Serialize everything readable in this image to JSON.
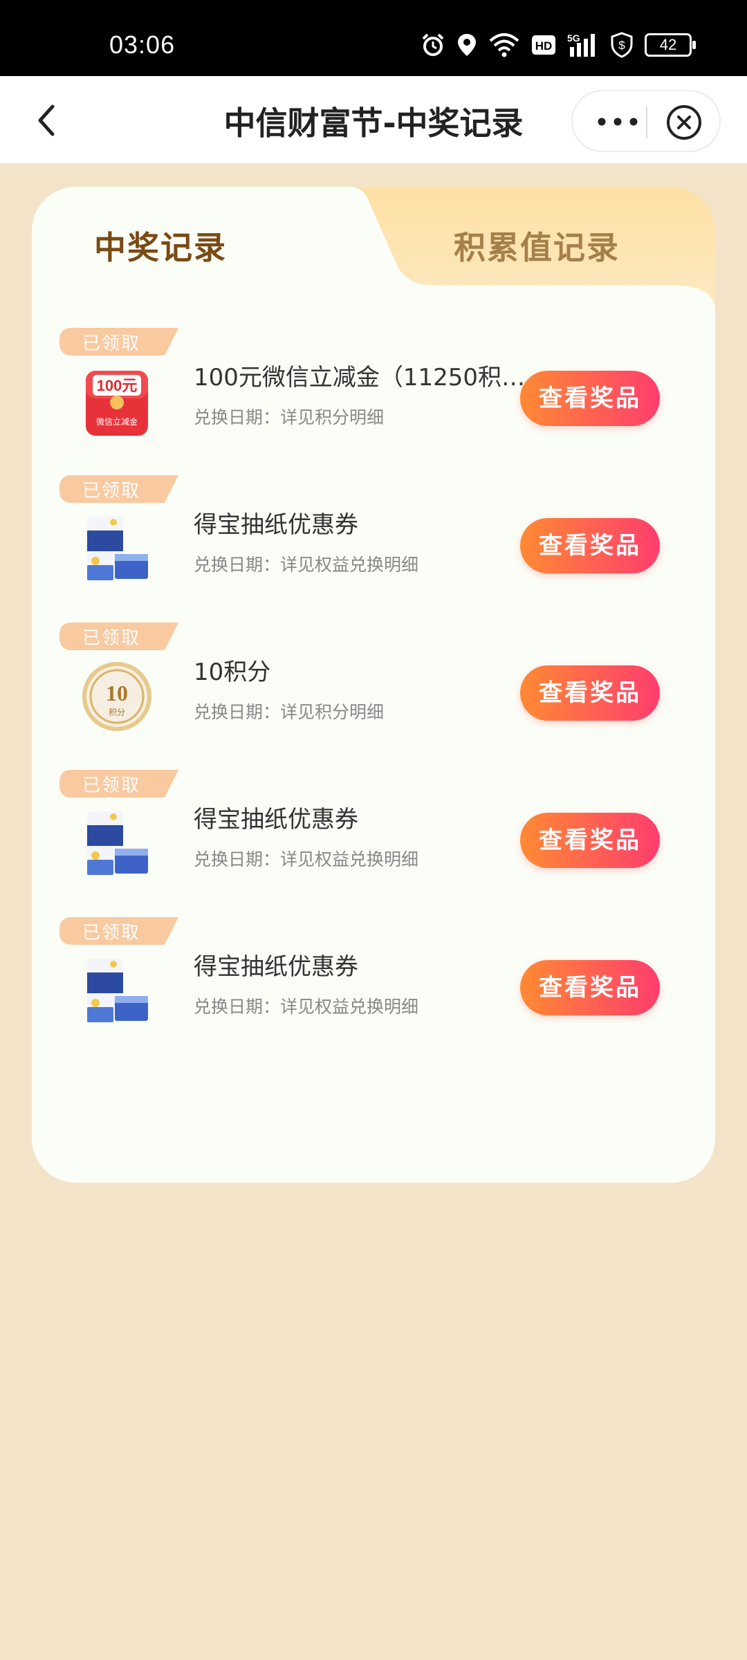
{
  "status_bar": {
    "time": "03:06",
    "network": "5G",
    "hd": "HD",
    "battery": "42",
    "icons": [
      "alarm-icon",
      "location-icon",
      "wifi-icon",
      "hd-icon",
      "signal-5g-icon",
      "shield-dollar-icon",
      "battery-icon"
    ]
  },
  "nav": {
    "title": "中信财富节-中奖记录",
    "back_icon": "chevron-left-icon",
    "more_icon": "more-dots-icon",
    "close_icon": "close-circle-icon"
  },
  "tabs": [
    {
      "label": "中奖记录",
      "active": true
    },
    {
      "label": "积累值记录",
      "active": false
    }
  ],
  "colors": {
    "background": "#f3e4c9",
    "tab_active_text": "#7a4a14",
    "tab_inactive_text": "#a5804a",
    "button_gradient_start": "#ff8a33",
    "button_gradient_end": "#ff3d6e",
    "tag_color": "#f9c9a0"
  },
  "records": [
    {
      "tag": "已领取",
      "thumb": "wechat-cash-voucher",
      "thumb_amount": "100元",
      "thumb_caption": "微信立减金",
      "title": "100元微信立减金（11250积分...",
      "subtitle": "兑换日期：详见积分明细",
      "button": "查看奖品"
    },
    {
      "tag": "已领取",
      "thumb": "tissue-product",
      "title": "得宝抽纸优惠券",
      "subtitle": "兑换日期：详见权益兑换明细",
      "button": "查看奖品"
    },
    {
      "tag": "已领取",
      "thumb": "points-coin",
      "thumb_amount": "10",
      "thumb_caption": "积分",
      "title": "10积分",
      "subtitle": "兑换日期：详见积分明细",
      "button": "查看奖品"
    },
    {
      "tag": "已领取",
      "thumb": "tissue-product",
      "title": "得宝抽纸优惠券",
      "subtitle": "兑换日期：详见权益兑换明细",
      "button": "查看奖品"
    },
    {
      "tag": "已领取",
      "thumb": "tissue-product",
      "title": "得宝抽纸优惠券",
      "subtitle": "兑换日期：详见权益兑换明细",
      "button": "查看奖品"
    }
  ]
}
